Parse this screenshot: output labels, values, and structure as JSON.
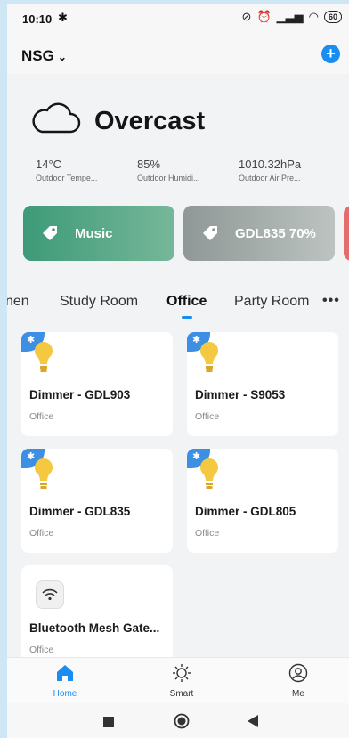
{
  "status": {
    "time": "10:10",
    "battery": "60"
  },
  "header": {
    "home_name": "NSG"
  },
  "weather": {
    "condition": "Overcast",
    "stats": [
      {
        "value": "14°C",
        "label": "Outdoor Tempe..."
      },
      {
        "value": "85%",
        "label": "Outdoor Humidi..."
      },
      {
        "value": "1010.32hPa",
        "label": "Outdoor Air Pre..."
      }
    ]
  },
  "scenes": [
    {
      "label": "Music"
    },
    {
      "label": "GDL835 70%"
    }
  ],
  "tabs": [
    "nen",
    "Study Room",
    "Office",
    "Party Room"
  ],
  "active_tab": "Office",
  "devices": [
    {
      "name": "Dimmer - GDL903",
      "room": "Office"
    },
    {
      "name": "Dimmer - S9053",
      "room": "Office"
    },
    {
      "name": "Dimmer - GDL835",
      "room": "Office"
    },
    {
      "name": "Dimmer - GDL805",
      "room": "Office"
    },
    {
      "name": "Bluetooth Mesh Gate...",
      "room": "Office"
    }
  ],
  "bottom_nav": [
    {
      "label": "Home"
    },
    {
      "label": "Smart"
    },
    {
      "label": "Me"
    }
  ],
  "colors": {
    "accent": "#1a8df0",
    "music_card": "#3d9a78",
    "scene_card": "#8f9896",
    "bt_badge": "#3d8fe3",
    "bulb": "#f5c842"
  }
}
